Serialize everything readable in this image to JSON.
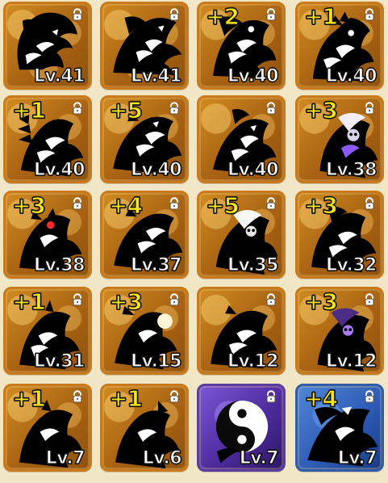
{
  "screen": {
    "name": "unit-roster-grid"
  },
  "units": [
    {
      "level_text": "Lv.41",
      "plus_text": "",
      "theme": "gold",
      "art_icon": "black-dragon-icon"
    },
    {
      "level_text": "Lv.41",
      "plus_text": "",
      "theme": "gold",
      "art_icon": "black-dragon-icon"
    },
    {
      "level_text": "Lv.40",
      "plus_text": "+2",
      "theme": "gold",
      "art_icon": "dark-beast-icon"
    },
    {
      "level_text": "Lv.40",
      "plus_text": "+1",
      "theme": "gold",
      "art_icon": "dark-warrior-icon"
    },
    {
      "level_text": "Lv.40",
      "plus_text": "+1",
      "theme": "gold",
      "art_icon": "feather-beast-icon"
    },
    {
      "level_text": "Lv.40",
      "plus_text": "+5",
      "theme": "gold",
      "art_icon": "black-dragon-icon"
    },
    {
      "level_text": "Lv.40",
      "plus_text": "",
      "theme": "gold",
      "art_icon": "dark-beast-icon"
    },
    {
      "level_text": "Lv.38",
      "plus_text": "+3",
      "theme": "gold",
      "art_icon": "hooded-skeleton-icon"
    },
    {
      "level_text": "Lv.38",
      "plus_text": "+3",
      "theme": "gold",
      "art_icon": "dark-warrior-icon"
    },
    {
      "level_text": "Lv.37",
      "plus_text": "+4",
      "theme": "gold",
      "art_icon": "black-dragon-icon"
    },
    {
      "level_text": "Lv.35",
      "plus_text": "+5",
      "theme": "gold",
      "art_icon": "hooded-skeleton-icon"
    },
    {
      "level_text": "Lv.32",
      "plus_text": "+3",
      "theme": "gold",
      "art_icon": "dark-beast-icon"
    },
    {
      "level_text": "Lv.31",
      "plus_text": "+1",
      "theme": "gold",
      "art_icon": "dark-warrior-icon"
    },
    {
      "level_text": "Lv.15",
      "plus_text": "+3",
      "theme": "gold",
      "art_icon": "dark-beast-icon"
    },
    {
      "level_text": "Lv.12",
      "plus_text": "",
      "theme": "gold",
      "art_icon": "black-dragon-icon"
    },
    {
      "level_text": "Lv.12",
      "plus_text": "+3",
      "theme": "gold",
      "art_icon": "hooded-skeleton-icon"
    },
    {
      "level_text": "Lv.7",
      "plus_text": "+1",
      "theme": "gold",
      "art_icon": "dark-warrior-icon"
    },
    {
      "level_text": "Lv.6",
      "plus_text": "+1",
      "theme": "gold",
      "art_icon": "dark-beast-icon"
    },
    {
      "level_text": "Lv.7",
      "plus_text": "",
      "theme": "purple",
      "art_icon": "yin-yang-icon"
    },
    {
      "level_text": "Lv.7",
      "plus_text": "+4",
      "theme": "blue",
      "art_icon": "blue-spirit-icon"
    }
  ]
}
